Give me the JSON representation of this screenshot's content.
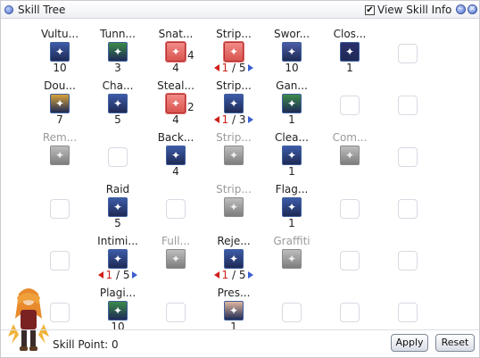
{
  "window": {
    "title": "Skill Tree",
    "view_skill_info_label": "View Skill Info",
    "view_skill_info_checked": "✔",
    "minimize_glyph": "–",
    "close_glyph": "×"
  },
  "skills": [
    {
      "id": "vulture",
      "name": "Vultu...",
      "level": "10",
      "icon": "eagle-eye-icon",
      "color": "#3d5ba8",
      "state": "active",
      "row": 0,
      "col": 0
    },
    {
      "id": "tunnel",
      "name": "Tunn...",
      "level": "3",
      "icon": "tunnel-drive-icon",
      "color": "#3c8a4a",
      "state": "active",
      "row": 0,
      "col": 1
    },
    {
      "id": "snatch",
      "name": "Snat...",
      "level": "4",
      "icon": "snatch-hand-icon",
      "color": "#d9544f",
      "state": "selected",
      "row": 0,
      "col": 2,
      "badge": "4"
    },
    {
      "id": "strip1",
      "name": "Strip...",
      "icon": "strip-weapon-icon",
      "color": "#d9544f",
      "state": "selected",
      "row": 0,
      "col": 3,
      "current": "1",
      "max": "5"
    },
    {
      "id": "sword",
      "name": "Swor...",
      "level": "10",
      "icon": "sword-icon",
      "color": "#4b5ea6",
      "state": "active",
      "row": 0,
      "col": 4
    },
    {
      "id": "close",
      "name": "Clos...",
      "level": "1",
      "icon": "close-confine-icon",
      "color": "#2a2f6c",
      "state": "active",
      "row": 0,
      "col": 5
    },
    {
      "id": "double",
      "name": "Dou...",
      "level": "7",
      "icon": "double-strafe-icon",
      "color": "#d6a23a",
      "state": "active",
      "row": 1,
      "col": 0
    },
    {
      "id": "chase",
      "name": "Cha...",
      "level": "5",
      "icon": "chase-walk-icon",
      "color": "#3d5ba8",
      "state": "active",
      "row": 1,
      "col": 1
    },
    {
      "id": "steal",
      "name": "Steal...",
      "level": "4",
      "icon": "steal-coin-icon",
      "color": "#d9544f",
      "state": "selected",
      "row": 1,
      "col": 2,
      "badge": "2"
    },
    {
      "id": "strip2",
      "name": "Strip...",
      "icon": "strip-shield-icon",
      "color": "#3d5ba8",
      "state": "active",
      "row": 1,
      "col": 3,
      "current": "1",
      "max": "3"
    },
    {
      "id": "gangster",
      "name": "Gan...",
      "level": "1",
      "icon": "gangster-paradise-icon",
      "color": "#3c8a4a",
      "state": "active",
      "row": 1,
      "col": 4
    },
    {
      "id": "remove",
      "name": "Rem...",
      "icon": "remove-trap-icon",
      "color": "#9a9a9a",
      "state": "disabled",
      "row": 2,
      "col": 0
    },
    {
      "id": "backstab",
      "name": "Back...",
      "level": "4",
      "icon": "backstab-icon",
      "color": "#3d5ba8",
      "state": "active",
      "row": 2,
      "col": 2
    },
    {
      "id": "strip3",
      "name": "Strip...",
      "icon": "strip-armor-icon",
      "color": "#9a9a9a",
      "state": "disabled",
      "row": 2,
      "col": 3
    },
    {
      "id": "clean",
      "name": "Clea...",
      "level": "1",
      "icon": "cleaner-icon",
      "color": "#3d5ba8",
      "state": "active",
      "row": 2,
      "col": 4
    },
    {
      "id": "compulsion",
      "name": "Com...",
      "icon": "compulsion-discount-icon",
      "color": "#9a9a9a",
      "state": "disabled",
      "row": 2,
      "col": 5
    },
    {
      "id": "raid",
      "name": "Raid",
      "level": "5",
      "icon": "raid-icon",
      "color": "#3d5ba8",
      "state": "active",
      "row": 3,
      "col": 1
    },
    {
      "id": "strip4",
      "name": "Strip...",
      "icon": "strip-helm-icon",
      "color": "#9a9a9a",
      "state": "disabled",
      "row": 3,
      "col": 3
    },
    {
      "id": "flag",
      "name": "Flag...",
      "level": "1",
      "icon": "flag-graffiti-icon",
      "color": "#3d5ba8",
      "state": "active",
      "row": 3,
      "col": 4
    },
    {
      "id": "intimidate",
      "name": "Intimi...",
      "icon": "intimidate-icon",
      "color": "#3d5ba8",
      "state": "active",
      "row": 4,
      "col": 1,
      "current": "1",
      "max": "5"
    },
    {
      "id": "full",
      "name": "Full...",
      "icon": "full-strip-icon",
      "color": "#9a9a9a",
      "state": "disabled",
      "row": 4,
      "col": 2
    },
    {
      "id": "reject",
      "name": "Reje...",
      "icon": "reject-sword-icon",
      "color": "#3d5ba8",
      "state": "active",
      "row": 4,
      "col": 3,
      "current": "1",
      "max": "5"
    },
    {
      "id": "graffiti",
      "name": "Graffiti",
      "icon": "graffiti-icon",
      "color": "#9a9a9a",
      "state": "disabled",
      "row": 4,
      "col": 4
    },
    {
      "id": "plagiarism",
      "name": "Plagi...",
      "level": "10",
      "icon": "plagiarism-icon",
      "color": "#3c8a4a",
      "state": "active",
      "row": 5,
      "col": 1
    },
    {
      "id": "preserve",
      "name": "Pres...",
      "level": "1",
      "icon": "preserve-icon",
      "color": "#e0b7a0",
      "state": "active",
      "row": 5,
      "col": 3
    }
  ],
  "empty_slots": [
    [
      0,
      6
    ],
    [
      1,
      5
    ],
    [
      1,
      6
    ],
    [
      2,
      1
    ],
    [
      2,
      6
    ],
    [
      3,
      0
    ],
    [
      3,
      2
    ],
    [
      3,
      5
    ],
    [
      3,
      6
    ],
    [
      4,
      0
    ],
    [
      4,
      5
    ],
    [
      4,
      6
    ],
    [
      5,
      0
    ],
    [
      5,
      2
    ],
    [
      5,
      4
    ],
    [
      5,
      5
    ],
    [
      5,
      6
    ]
  ],
  "footer": {
    "skill_point_label": "Skill Point: 0",
    "apply_label": "Apply",
    "reset_label": "Reset"
  },
  "icons": {
    "character": "character-sprite-icon"
  }
}
